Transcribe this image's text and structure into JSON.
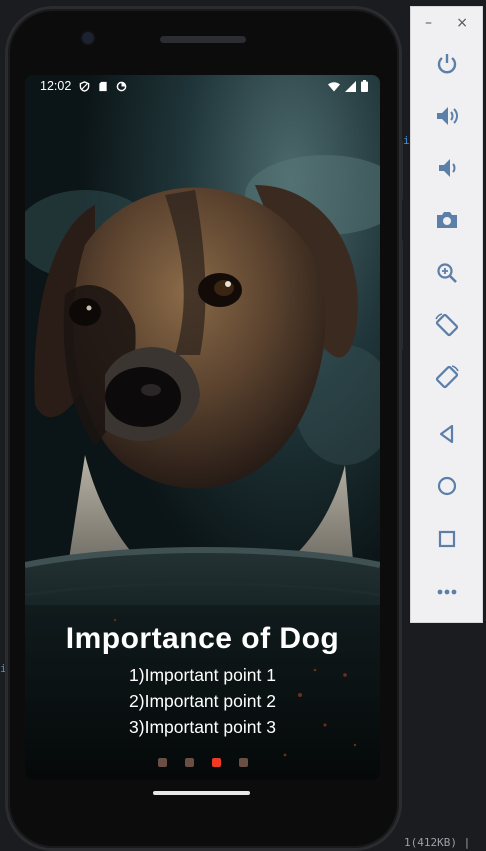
{
  "status_bar": {
    "time": "12:02"
  },
  "screen": {
    "title": "Importance of Dog",
    "points": [
      "1)Important point 1",
      "2)Important point 2",
      "3)Important point 3"
    ],
    "pager": {
      "total": 4,
      "active_index": 2
    }
  },
  "emulator_toolbar": {
    "minimize_label": "–",
    "close_label": "×",
    "buttons": [
      "power-icon",
      "volume-up-icon",
      "volume-down-icon",
      "camera-icon",
      "zoom-icon",
      "rotate-left-icon",
      "rotate-right-icon",
      "back-icon",
      "home-icon",
      "overview-icon",
      "more-icon"
    ]
  },
  "ide_background": {
    "footer_text": "1(412KB) |"
  },
  "colors": {
    "accent_dot": "#f03a22",
    "inactive_dot": "#6b4f45",
    "toolbar_icon": "#5b7fa8"
  }
}
